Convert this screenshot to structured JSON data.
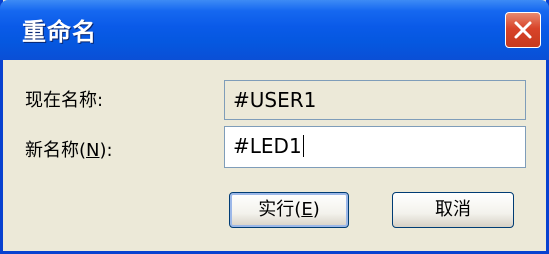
{
  "dialog": {
    "title": "重命名",
    "current_name_label": "现在名称:",
    "current_name_value": "#USER1",
    "new_name_label_prefix": "新名称(",
    "new_name_label_accel": "N",
    "new_name_label_suffix": "):",
    "new_name_value": "#LED1",
    "ok_label_prefix": "实行(",
    "ok_label_accel": "E",
    "ok_label_suffix": ")",
    "cancel_label": "取消"
  },
  "colors": {
    "titlebar": "#0a5ae8",
    "close_button": "#d8442a",
    "dialog_background": "#ece9d8"
  },
  "icons": {
    "close": "close-icon"
  }
}
